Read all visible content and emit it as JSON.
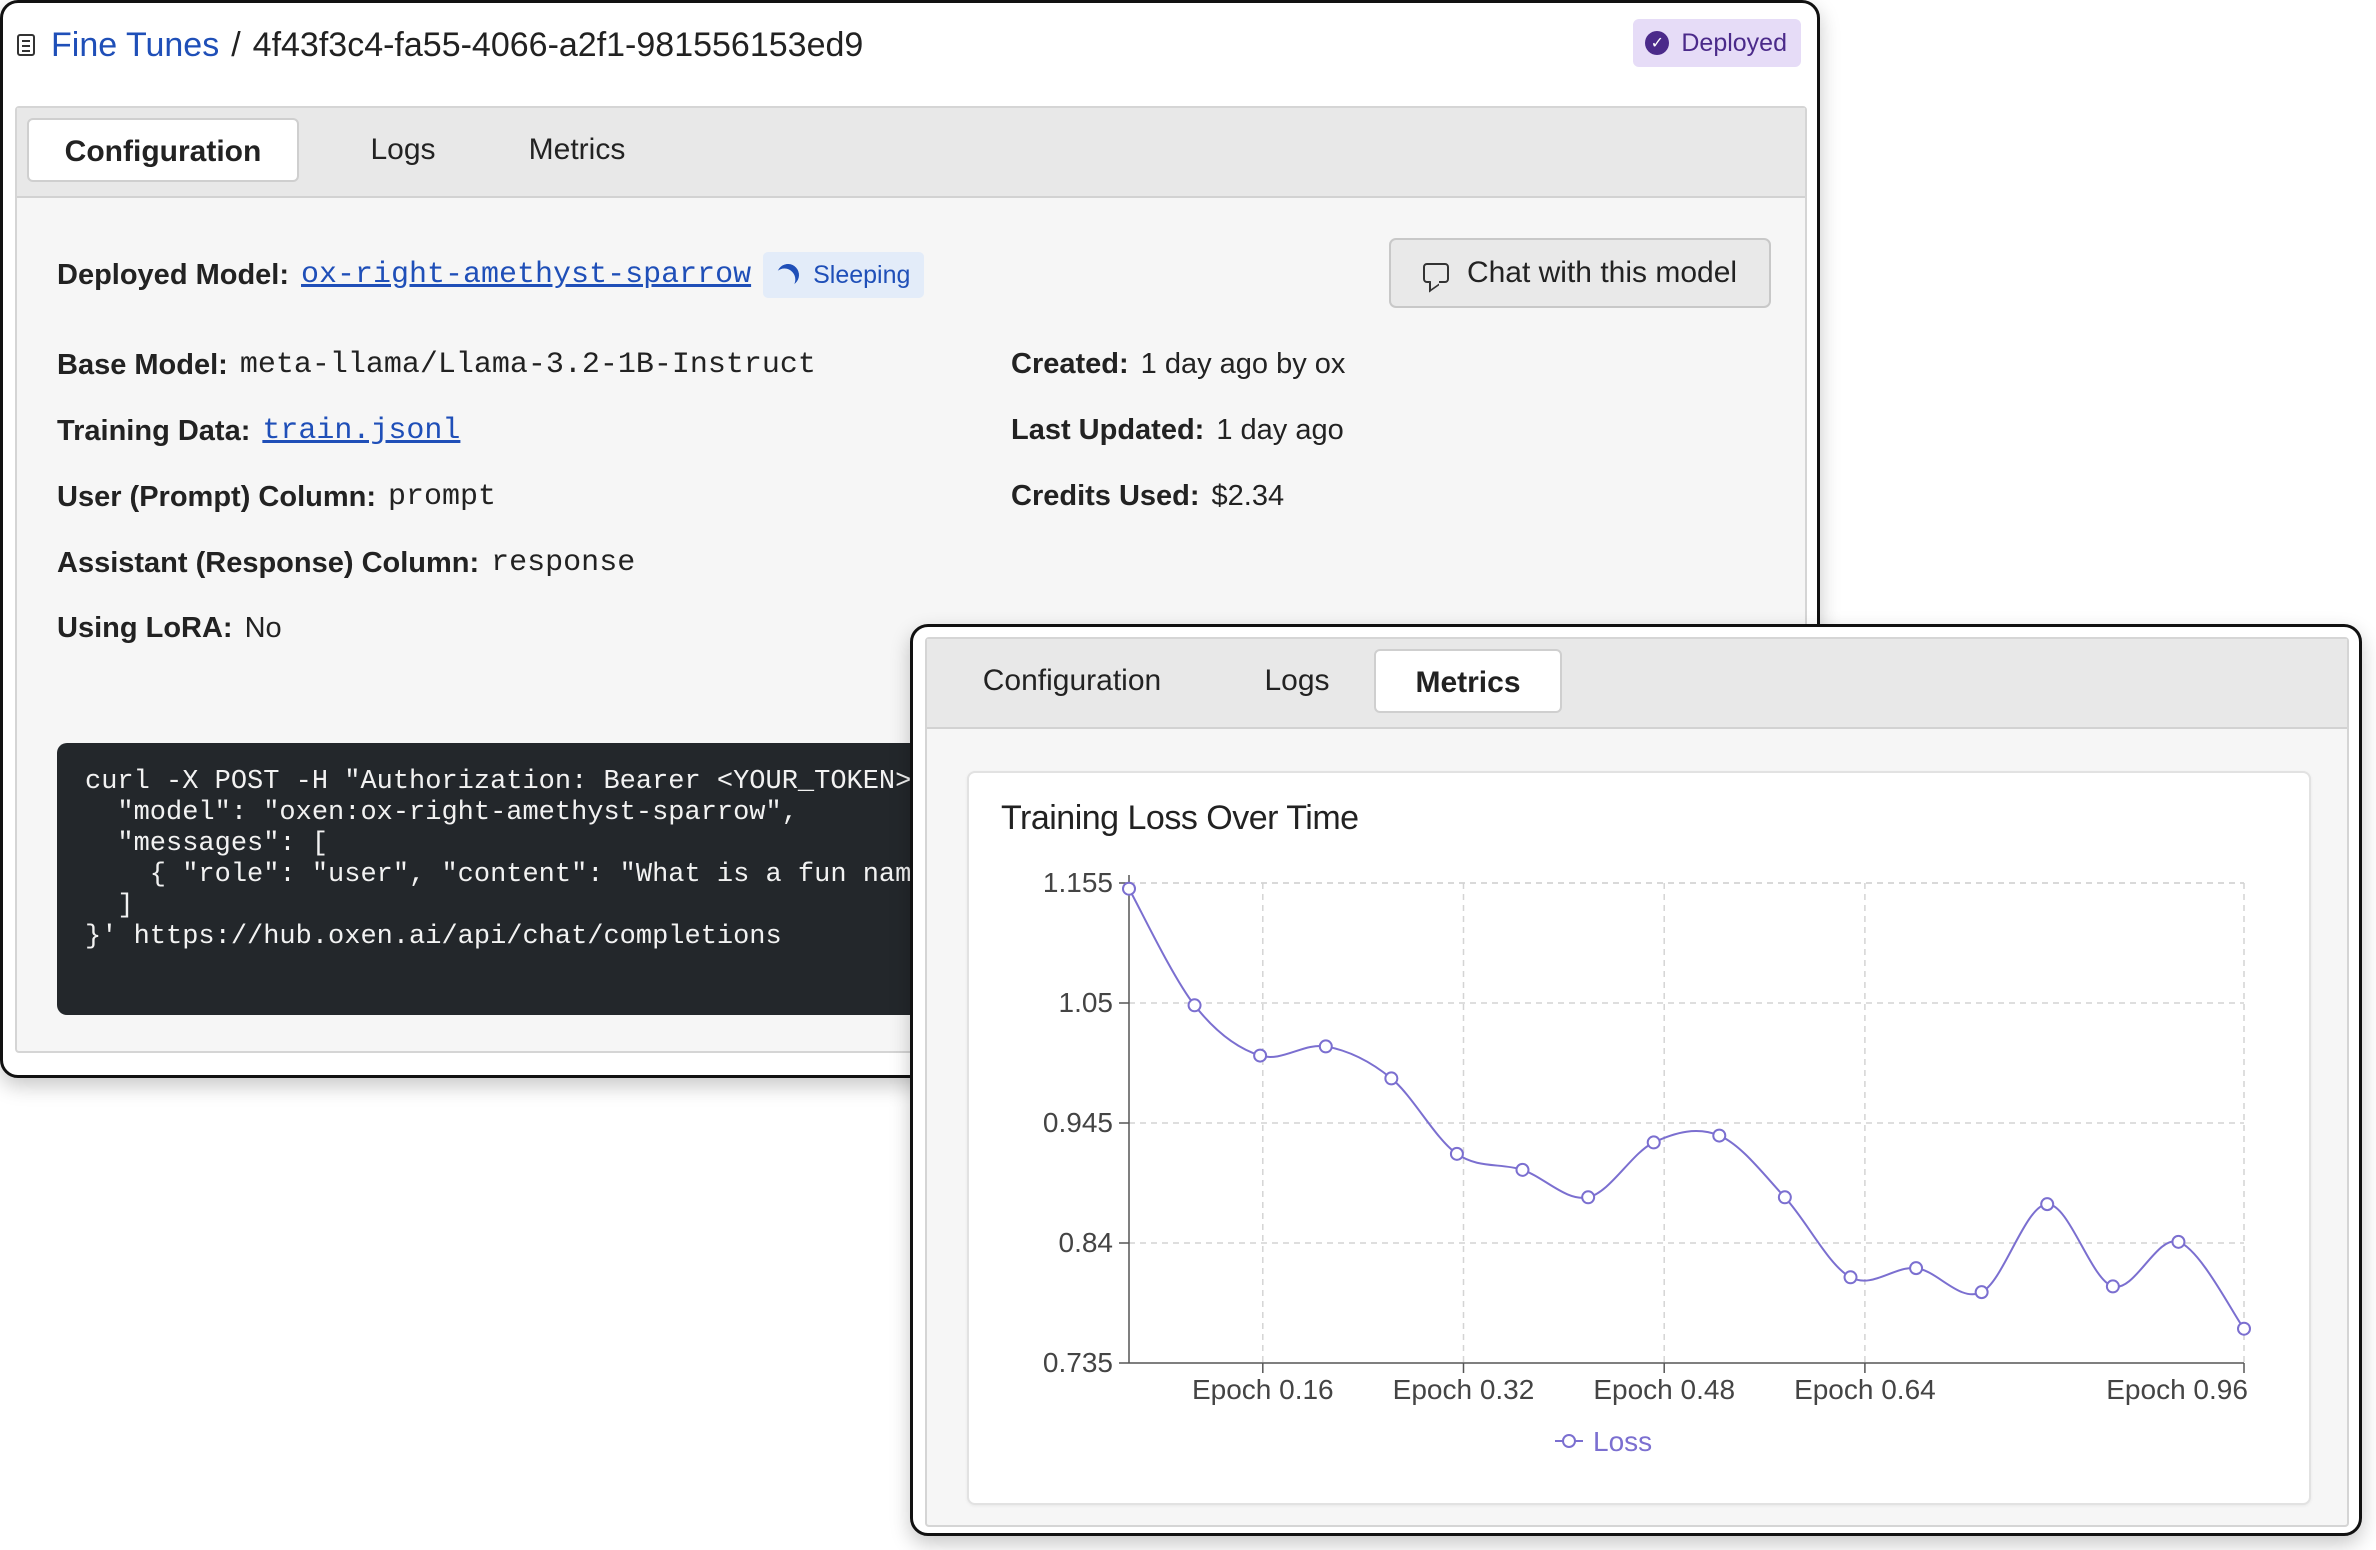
{
  "back_window": {
    "breadcrumb": {
      "root": "Fine Tunes",
      "separator": "/",
      "id": "4f43f3c4-fa55-4066-a2f1-981556153ed9"
    },
    "status_badge": "Deployed",
    "tabs": [
      "Configuration",
      "Logs",
      "Metrics"
    ],
    "active_tab": "Configuration",
    "deployed_model": {
      "label": "Deployed Model:",
      "value": "ox-right-amethyst-sparrow",
      "status": "Sleeping"
    },
    "chat_button": "Chat with this model",
    "left_fields": [
      {
        "label": "Base Model:",
        "value": "meta-llama/Llama-3.2-1B-Instruct"
      },
      {
        "label": "Training Data:",
        "value": "train.jsonl"
      },
      {
        "label": "User (Prompt) Column:",
        "value": "prompt"
      },
      {
        "label": "Assistant (Response) Column:",
        "value": "response"
      },
      {
        "label": "Using LoRA:",
        "value": "No"
      }
    ],
    "right_fields": [
      {
        "label": "Created:",
        "value": "1 day ago by ox"
      },
      {
        "label": "Last Updated:",
        "value": "1 day ago"
      },
      {
        "label": "Credits Used:",
        "value": "$2.34"
      }
    ],
    "code_lines": [
      "curl -X POST -H \"Authorization: Bearer <YOUR_TOKEN>\"",
      "  \"model\": \"oxen:ox-right-amethyst-sparrow\",",
      "  \"messages\": [",
      "    { \"role\": \"user\", \"content\": \"What is a fun name",
      "  ]",
      "}' https://hub.oxen.ai/api/chat/completions"
    ]
  },
  "front_window": {
    "tabs": [
      "Configuration",
      "Logs",
      "Metrics"
    ],
    "active_tab": "Metrics"
  },
  "chart_data": {
    "type": "line",
    "title": "Training Loss Over Time",
    "x_tick_labels": [
      "Epoch 0.16",
      "Epoch 0.32",
      "Epoch 0.48",
      "Epoch 0.64",
      "Epoch 0.96"
    ],
    "y_tick_labels": [
      "1.155",
      "1.05",
      "0.945",
      "0.84",
      "0.735"
    ],
    "ylim": [
      0.735,
      1.155
    ],
    "xlim": [
      0,
      1
    ],
    "grid": true,
    "legend_position": "bottom",
    "series": [
      {
        "name": "Loss",
        "color": "#7b6fd0",
        "x": [
          0.0,
          0.0588,
          0.1176,
          0.1765,
          0.2353,
          0.2941,
          0.3529,
          0.4118,
          0.4706,
          0.5294,
          0.5882,
          0.6471,
          0.7059,
          0.7647,
          0.8235,
          0.8824,
          0.9412,
          1.0
        ],
        "values": [
          1.15,
          1.048,
          1.004,
          1.012,
          0.984,
          0.918,
          0.904,
          0.88,
          0.928,
          0.934,
          0.88,
          0.81,
          0.818,
          0.797,
          0.874,
          0.802,
          0.841,
          0.765
        ]
      }
    ]
  }
}
